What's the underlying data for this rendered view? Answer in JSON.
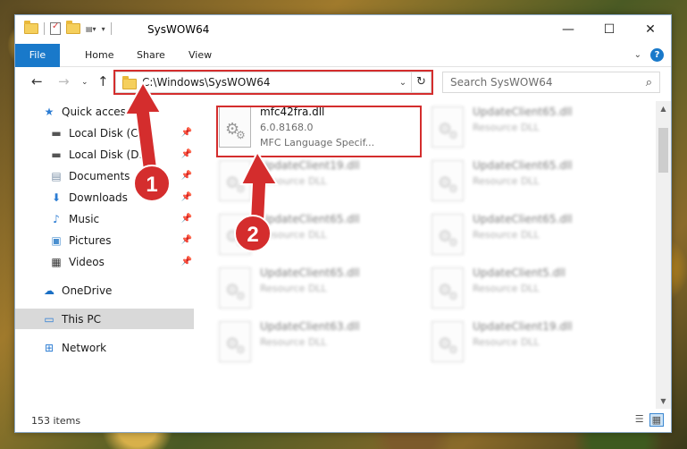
{
  "window": {
    "title": "SysWOW64",
    "controls": {
      "minimize": "—",
      "maximize": "☐",
      "close": "✕"
    }
  },
  "ribbon": {
    "tabs": [
      "File",
      "Home",
      "Share",
      "View"
    ],
    "help": "?",
    "expand": "⌄"
  },
  "nav": {
    "back": "←",
    "forward": "→",
    "recent": "⌄",
    "up": "↑"
  },
  "address": {
    "path": "C:\\Windows\\SysWOW64",
    "dropdown": "⌄",
    "refresh": "↻"
  },
  "search": {
    "placeholder": "Search SysWOW64",
    "icon": "search-icon"
  },
  "sidebar": {
    "items": [
      {
        "label": "Quick access",
        "icon": "star-icon",
        "pinned": false
      },
      {
        "label": "Local Disk (C:)",
        "icon": "drive-icon",
        "pinned": true
      },
      {
        "label": "Local Disk (D:)",
        "icon": "drive-icon",
        "pinned": true
      },
      {
        "label": "Documents",
        "icon": "documents-icon",
        "pinned": true
      },
      {
        "label": "Downloads",
        "icon": "downloads-icon",
        "pinned": true
      },
      {
        "label": "Music",
        "icon": "music-icon",
        "pinned": true
      },
      {
        "label": "Pictures",
        "icon": "pictures-icon",
        "pinned": true
      },
      {
        "label": "Videos",
        "icon": "videos-icon",
        "pinned": true
      },
      {
        "label": "OneDrive",
        "icon": "onedrive-icon",
        "pinned": false
      },
      {
        "label": "This PC",
        "icon": "pc-icon",
        "pinned": false,
        "selected": true
      },
      {
        "label": "Network",
        "icon": "network-icon",
        "pinned": false
      }
    ]
  },
  "files": [
    {
      "name": "mfc42fra.dll",
      "line2": "6.0.8168.0",
      "line3": "MFC Language Specif...",
      "blurred": false
    },
    {
      "name": "UpdateClient65.dll",
      "line2": "Resource DLL",
      "blurred": true
    },
    {
      "name": "UpdateClient19.dll",
      "line2": "Resource DLL",
      "blurred": true
    },
    {
      "name": "UpdateClient65.dll",
      "line2": "Resource DLL",
      "blurred": true
    },
    {
      "name": "UpdateClient65.dll",
      "line2": "Resource DLL",
      "blurred": true
    },
    {
      "name": "UpdateClient65.dll",
      "line2": "Resource DLL",
      "blurred": true
    },
    {
      "name": "UpdateClient65.dll",
      "line2": "Resource DLL",
      "blurred": true
    },
    {
      "name": "UpdateClient5.dll",
      "line2": "Resource DLL",
      "blurred": true
    },
    {
      "name": "UpdateClient63.dll",
      "line2": "Resource DLL",
      "blurred": true
    },
    {
      "name": "UpdateClient19.dll",
      "line2": "Resource DLL",
      "blurred": true
    }
  ],
  "status": {
    "item_count": "153 items"
  },
  "annotations": {
    "callout1": "1",
    "callout2": "2",
    "color": "#d42d2d"
  }
}
